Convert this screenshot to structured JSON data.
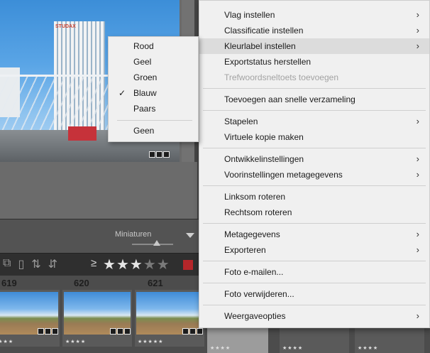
{
  "background": {
    "building_logo": "STUDAX",
    "toolbar": {
      "miniaturen_label": "Miniaturen"
    },
    "filter": {
      "rating_symbol": "≥"
    },
    "filmstrip": {
      "frame_numbers": [
        "619",
        "620",
        "621"
      ],
      "thumb_stars": [
        "★★★★",
        "★★★★",
        "★★★★★",
        "★★★★",
        "★★★★",
        "★★★★"
      ]
    }
  },
  "submenu": {
    "title": "Kleurlabel instellen",
    "items": [
      {
        "label": "Rood",
        "checked": false
      },
      {
        "label": "Geel",
        "checked": false
      },
      {
        "label": "Groen",
        "checked": false
      },
      {
        "label": "Blauw",
        "checked": true
      },
      {
        "label": "Paars",
        "checked": false
      },
      {
        "label": "Geen",
        "checked": false
      }
    ],
    "check_glyph": "✓"
  },
  "menu": {
    "arrow_glyph": "›",
    "items": [
      {
        "label": "Vlag instellen"
      },
      {
        "label": "Classificatie instellen"
      },
      {
        "label": "Kleurlabel instellen"
      },
      {
        "label": "Exportstatus herstellen"
      },
      {
        "label": "Trefwoordsneltoets toevoegen"
      },
      {
        "label": "Toevoegen aan snelle verzameling"
      },
      {
        "label": "Stapelen"
      },
      {
        "label": "Virtuele kopie maken"
      },
      {
        "label": "Ontwikkelinstellingen"
      },
      {
        "label": "Voorinstellingen metagegevens"
      },
      {
        "label": "Linksom roteren"
      },
      {
        "label": "Rechtsom roteren"
      },
      {
        "label": "Metagegevens"
      },
      {
        "label": "Exporteren"
      },
      {
        "label": "Foto e-mailen..."
      },
      {
        "label": "Foto verwijderen..."
      },
      {
        "label": "Weergaveopties"
      }
    ]
  }
}
